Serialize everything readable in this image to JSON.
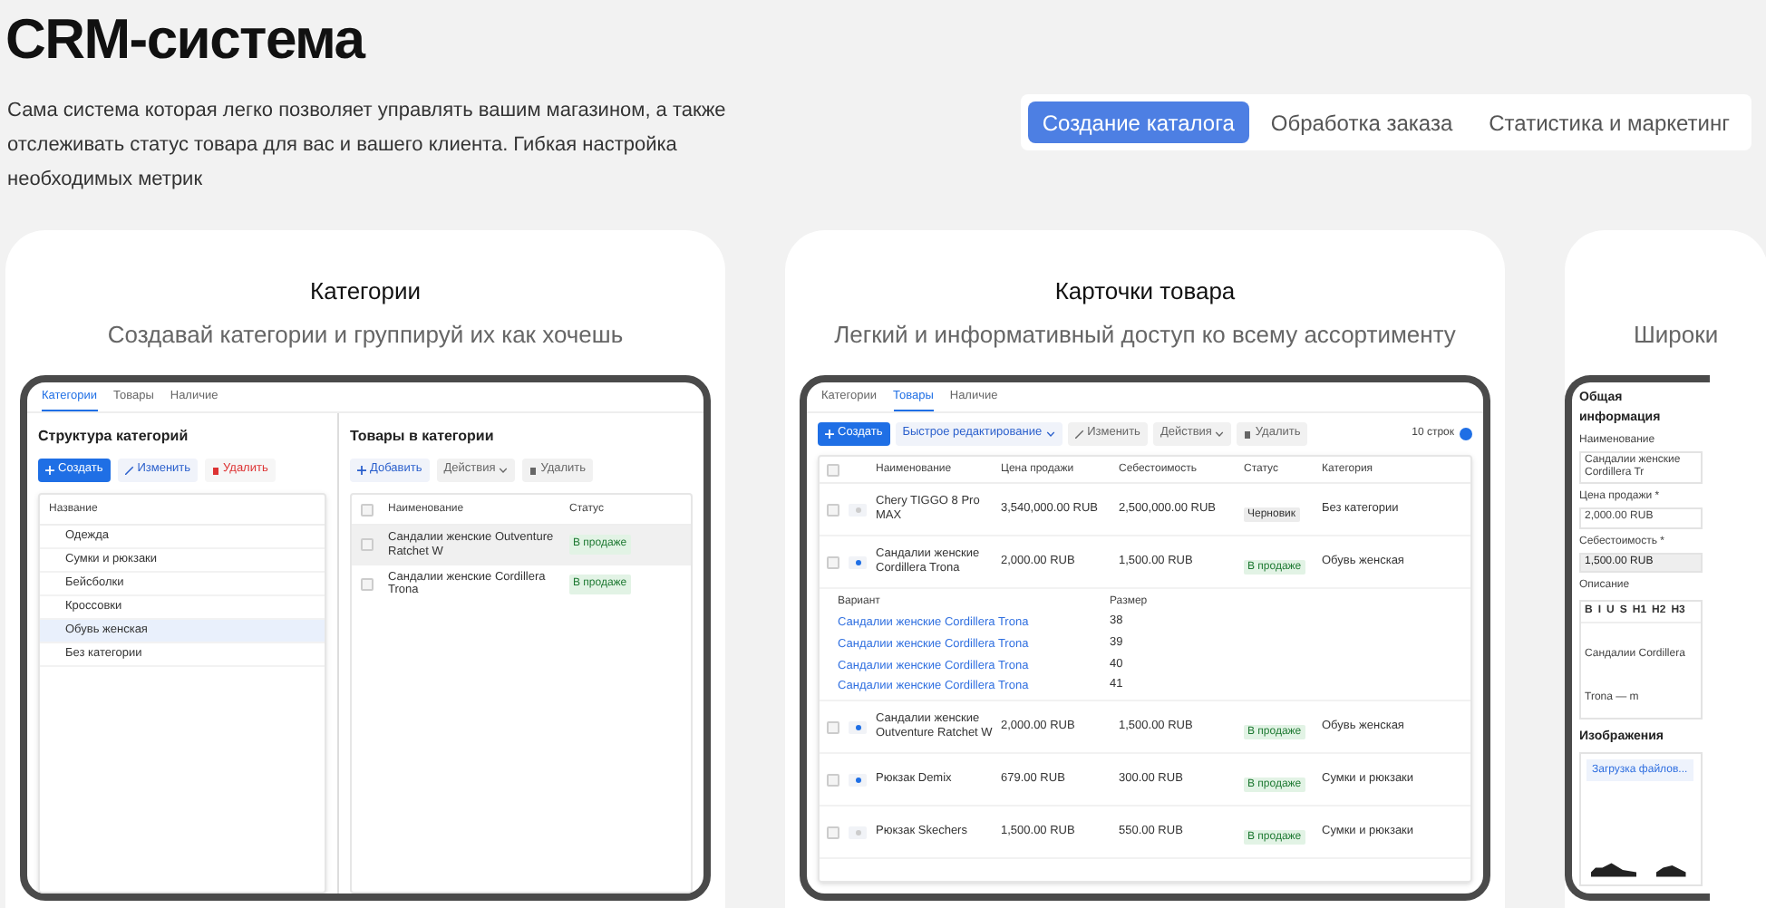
{
  "title": "CRM-система",
  "description": "Сама система которая легко позволяет управлять вашим магазином, а также отслеживать статус товара для вас и вашего клиента. Гибкая настройка необходимых метрик",
  "tabs": [
    {
      "label": "Создание каталога",
      "selected": true
    },
    {
      "label": "Обработка заказа",
      "selected": false
    },
    {
      "label": "Статистика и маркетинг",
      "selected": false
    }
  ],
  "cards": [
    {
      "kind": "categories",
      "title": "Категории",
      "subtitle": "Создавай категории и группируй их как хочешь",
      "mockup": {
        "tabs": [
          {
            "label": "Категории",
            "selected": true
          },
          {
            "label": "Товары",
            "selected": false
          },
          {
            "label": "Наличие",
            "selected": false
          }
        ],
        "left": {
          "title": "Структура категорий",
          "buttons": [
            {
              "label": "Создать",
              "kind": "primary",
              "disabled": false
            },
            {
              "label": "Изменить",
              "kind": "edit",
              "disabled": false
            },
            {
              "label": "Удалить",
              "kind": "delete",
              "disabled": false
            }
          ],
          "column": "Название",
          "items": [
            {
              "label": "Одежда",
              "selected": false
            },
            {
              "label": "Сумки и рюкзаки",
              "selected": false
            },
            {
              "label": "Бейсболки",
              "selected": false
            },
            {
              "label": "Кроссовки",
              "selected": false
            },
            {
              "label": "Обувь женская",
              "selected": true
            },
            {
              "label": "Без категории",
              "selected": false
            }
          ]
        },
        "right": {
          "title": "Товары в категории",
          "buttons": [
            {
              "label": "Добавить",
              "kind": "add",
              "disabled": false
            },
            {
              "label": "Действия",
              "kind": "menu",
              "disabled": true
            },
            {
              "label": "Удалить",
              "kind": "delete",
              "disabled": true
            }
          ],
          "columns": [
            "Наименование",
            "Статус"
          ],
          "all_checked": false,
          "rows": [
            {
              "name": "Сандалии женские Outventure Ratchet W",
              "status": "В продаже",
              "selected": true,
              "checked": false
            },
            {
              "name": "Сандалии женские Cordillera Trona",
              "status": "В продаже",
              "selected": false,
              "checked": false
            }
          ]
        }
      }
    },
    {
      "kind": "products",
      "title": "Карточки товара",
      "subtitle": "Легкий и информативный доступ ко всему ассортименту",
      "mockup": {
        "tabs": [
          {
            "label": "Категории",
            "selected": false
          },
          {
            "label": "Товары",
            "selected": true
          },
          {
            "label": "Наличие",
            "selected": false
          }
        ],
        "buttons": [
          {
            "label": "Создать",
            "kind": "primary",
            "disabled": false
          },
          {
            "label": "Быстрое редактирование",
            "kind": "menu",
            "disabled": false
          },
          {
            "label": "Изменить",
            "kind": "edit",
            "disabled": true
          },
          {
            "label": "Действия",
            "kind": "menu",
            "disabled": true
          },
          {
            "label": "Удалить",
            "kind": "delete",
            "disabled": true
          }
        ],
        "page_size": "10 строк",
        "columns": [
          "Наименование",
          "Цена продажи",
          "Себестоимость",
          "Статус",
          "Категория"
        ],
        "all_checked": false,
        "rows": [
          {
            "name": "Chery TIGGO 8 Pro MAX",
            "price": "3,540,000.00 RUB",
            "cost": "2,500,000.00 RUB",
            "status": {
              "label": "Черновик",
              "kind": "draft"
            },
            "category": "Без категории",
            "has_variants": false,
            "checked": false
          },
          {
            "name": "Сандалии женские Cordillera Trona",
            "price": "2,000.00 RUB",
            "cost": "1,500.00 RUB",
            "status": {
              "label": "В продаже",
              "kind": "sale"
            },
            "category": "Обувь женская",
            "has_variants": true,
            "checked": false,
            "variants": {
              "columns": [
                "Вариант",
                "Размер"
              ],
              "rows": [
                {
                  "name": "Сандалии женские Cordillera Trona",
                  "size": "38"
                },
                {
                  "name": "Сандалии женские Cordillera Trona",
                  "size": "39"
                },
                {
                  "name": "Сандалии женские Cordillera Trona",
                  "size": "40"
                },
                {
                  "name": "Сандалии женские Cordillera Trona",
                  "size": "41"
                }
              ]
            }
          },
          {
            "name": "Сандалии женские Outventure Ratchet W",
            "price": "2,000.00 RUB",
            "cost": "1,500.00 RUB",
            "status": {
              "label": "В продаже",
              "kind": "sale"
            },
            "category": "Обувь женская",
            "has_variants": true,
            "checked": false
          },
          {
            "name": "Рюкзак Demix",
            "price": "679.00 RUB",
            "cost": "300.00 RUB",
            "status": {
              "label": "В продаже",
              "kind": "sale"
            },
            "category": "Сумки и рюкзаки",
            "has_variants": true,
            "checked": false
          },
          {
            "name": "Рюкзак Skechers",
            "price": "1,500.00 RUB",
            "cost": "550.00 RUB",
            "status": {
              "label": "В продаже",
              "kind": "sale"
            },
            "category": "Сумки и рюкзаки",
            "has_variants": false,
            "checked": false
          }
        ]
      }
    },
    {
      "kind": "product_form",
      "subtitle": "Широки",
      "mockup": {
        "section": "Общая информация",
        "fields": [
          {
            "label": "Наименование",
            "value": "Сандалии женские Cordillera Tr",
            "disabled": false
          },
          {
            "label": "Цена продажи *",
            "value": "2,000.00 RUB",
            "disabled": false
          },
          {
            "label": "Себестоимость *",
            "value": "1,500.00 RUB",
            "disabled": true
          }
        ],
        "description_label": "Описание",
        "editor_tools": [
          "B",
          "I",
          "U",
          "S",
          "H1",
          "H2",
          "H3"
        ],
        "description": "Сандалии Cordillera Trona — m",
        "images_title": "Изображения",
        "upload": "Загрузка файлов..."
      }
    }
  ]
}
